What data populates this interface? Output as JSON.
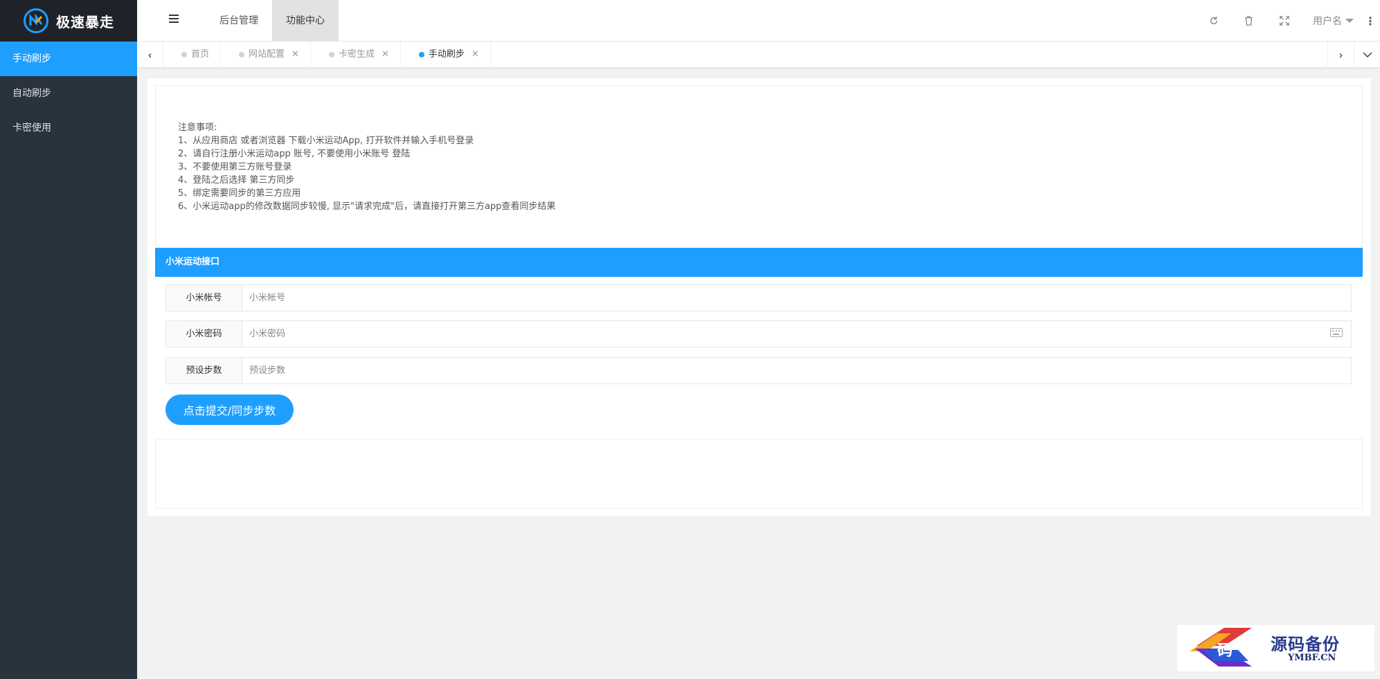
{
  "brand": {
    "name": "极速暴走"
  },
  "sidebar": {
    "items": [
      {
        "label": "手动刷步",
        "active": true
      },
      {
        "label": "自动刷步",
        "active": false
      },
      {
        "label": "卡密使用",
        "active": false
      }
    ]
  },
  "header": {
    "nav": [
      {
        "label": "后台管理",
        "active": false
      },
      {
        "label": "功能中心",
        "active": true
      }
    ],
    "username": "用户名"
  },
  "tabs": [
    {
      "label": "首页",
      "closable": false,
      "active": false
    },
    {
      "label": "网站配置",
      "closable": true,
      "active": false
    },
    {
      "label": "卡密生成",
      "closable": true,
      "active": false
    },
    {
      "label": "手动刷步",
      "closable": true,
      "active": true
    }
  ],
  "notice": {
    "title": "注意事项:",
    "lines": [
      "1、从应用商店 或者浏览器 下载小米运动App, 打开软件并输入手机号登录",
      "2、请自行注册小米运动app 账号, 不要使用小米账号 登陆",
      "3、不要使用第三方账号登录",
      "4、登陆之后选择 第三方同步",
      "5、绑定需要同步的第三方应用",
      "6、小米运动app的修改数据同步较慢, 显示\"请求完成\"后，请直接打开第三方app查看同步结果"
    ]
  },
  "form": {
    "section_title": "小米运动接口",
    "account": {
      "label": "小米帐号",
      "placeholder": "小米帐号",
      "value": ""
    },
    "password": {
      "label": "小米密码",
      "placeholder": "小米密码",
      "value": ""
    },
    "steps": {
      "label": "预设步数",
      "placeholder": "预设步数",
      "value": ""
    },
    "submit_label": "点击提交/同步步数"
  },
  "watermark": {
    "text": "源码备份",
    "sub": "YMBF.CN",
    "glyph": "码"
  },
  "colors": {
    "accent": "#1e9fff",
    "sidebar": "#28333e",
    "logo_bg": "#20222a"
  }
}
